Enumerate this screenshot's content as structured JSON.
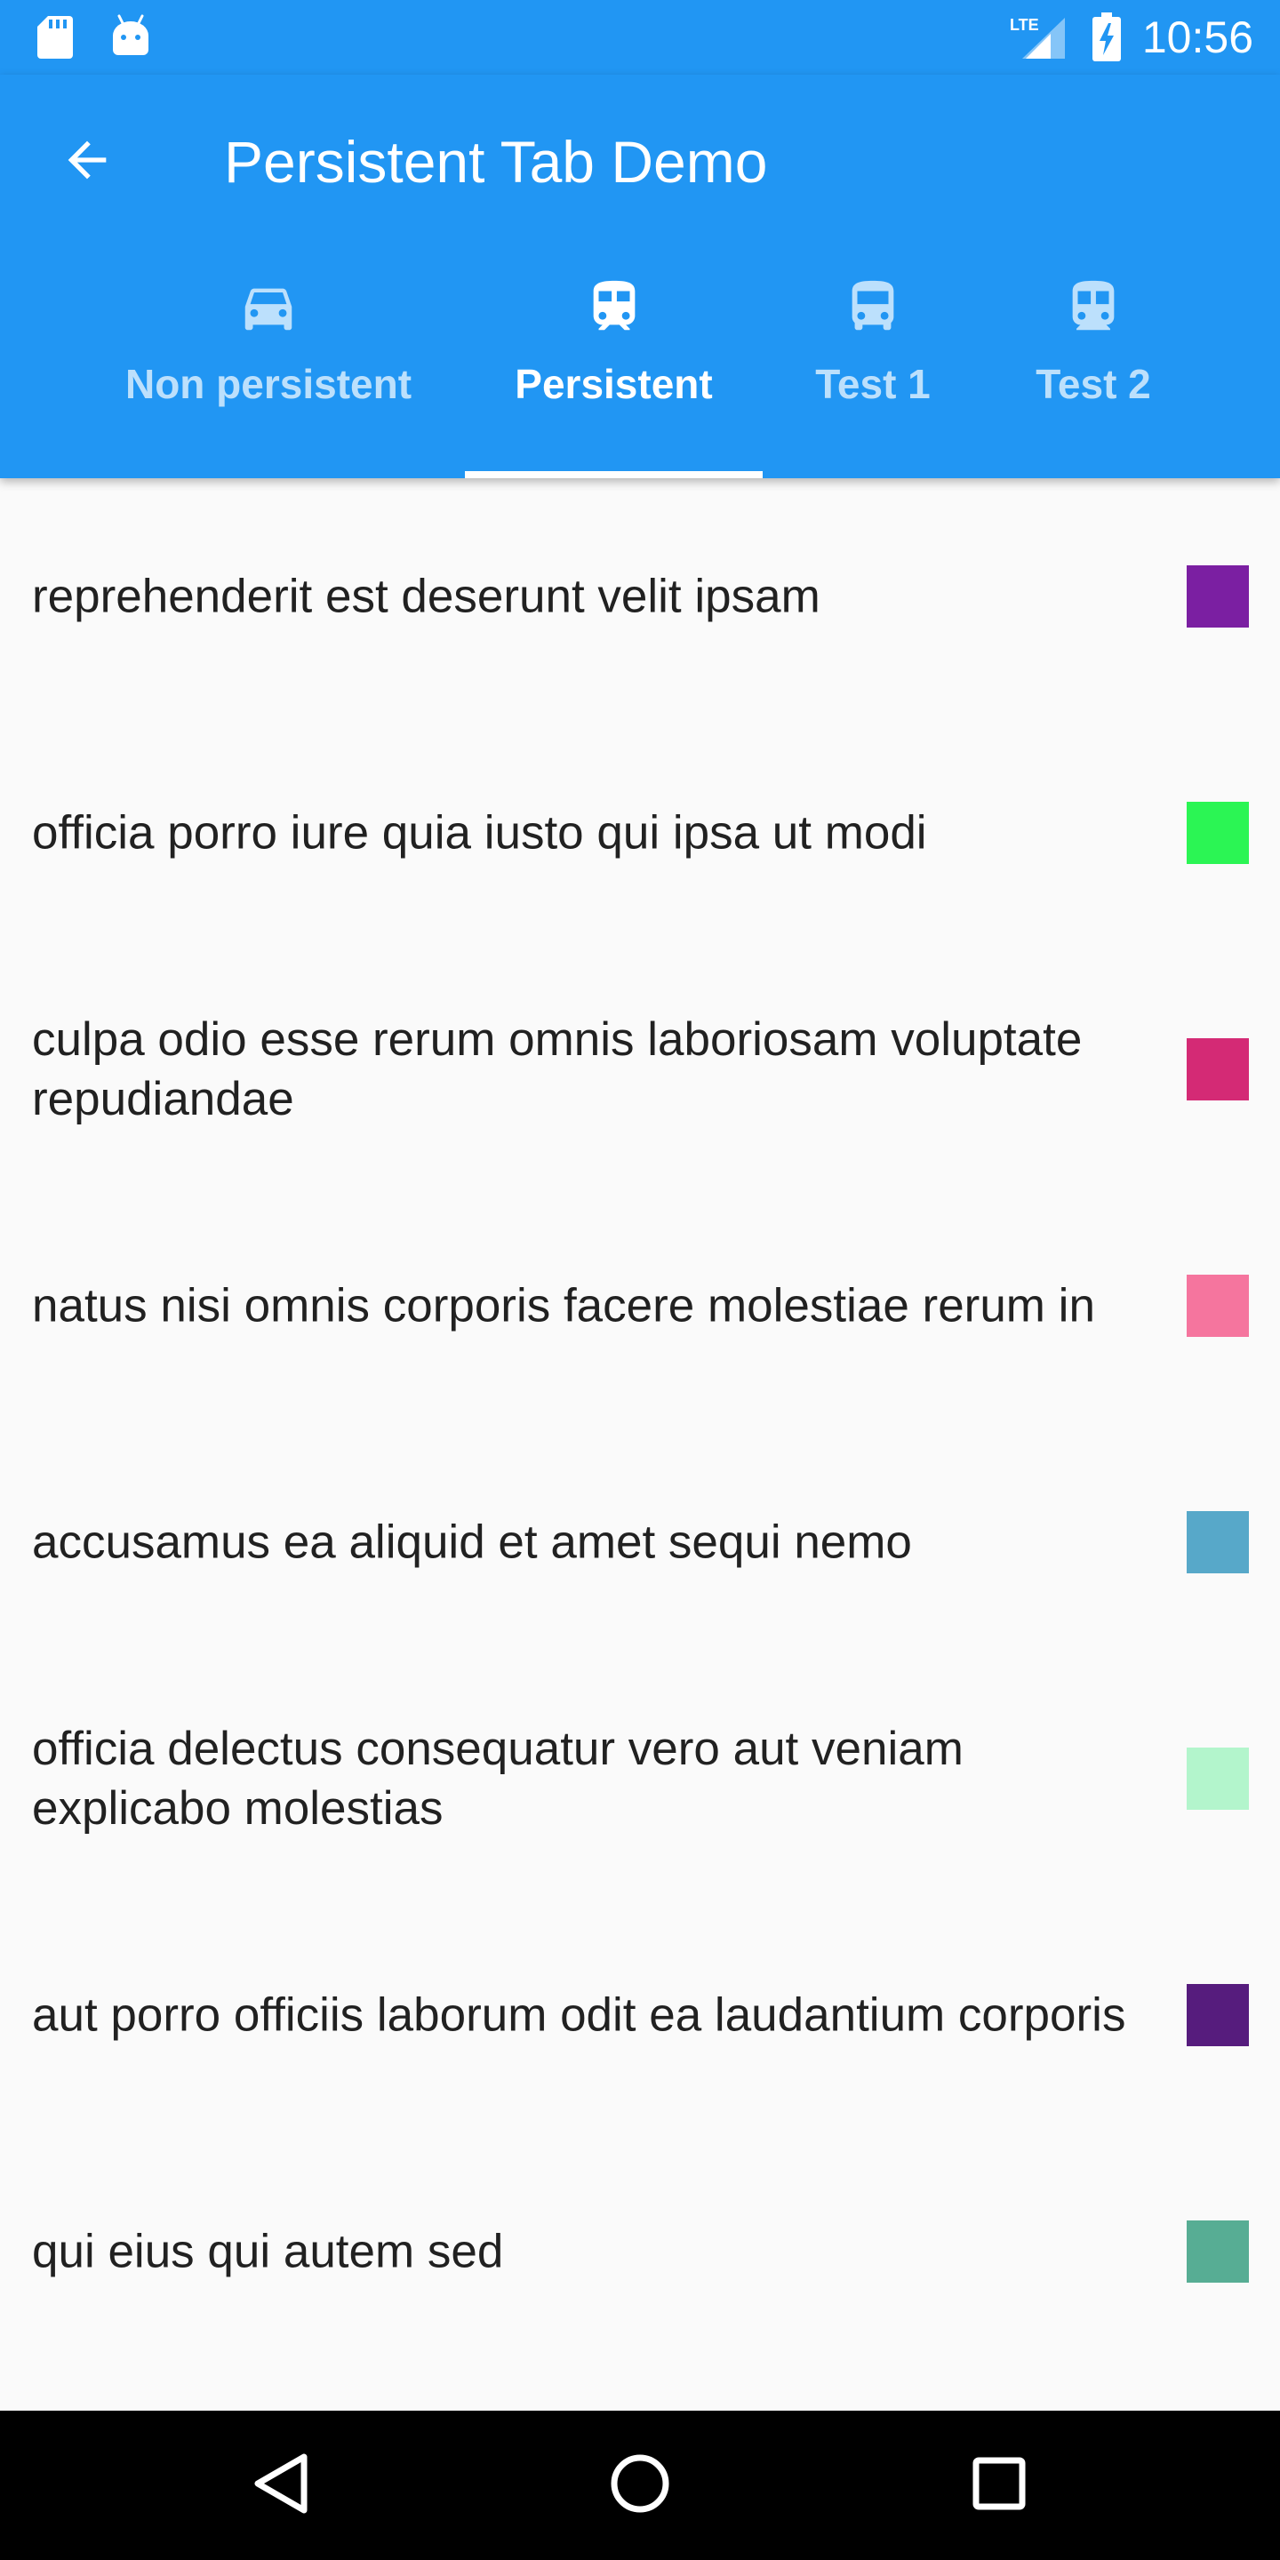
{
  "status_bar": {
    "time": "10:56",
    "icons": [
      "sd-card-icon",
      "android-icon",
      "lte-signal-icon",
      "battery-charging-icon"
    ]
  },
  "app_bar": {
    "title": "Persistent Tab Demo",
    "back_icon": "arrow-back-icon",
    "color": "#2196f3"
  },
  "tabs": [
    {
      "label": "Non persistent",
      "icon": "car-icon",
      "active": false
    },
    {
      "label": "Persistent",
      "icon": "train-icon",
      "active": true
    },
    {
      "label": "Test 1",
      "icon": "tram-icon",
      "active": false
    },
    {
      "label": "Test 2",
      "icon": "subway-icon",
      "active": false
    }
  ],
  "list": {
    "items": [
      {
        "text": "reprehenderit est deserunt velit ipsam",
        "color": "#7b1fa2"
      },
      {
        "text": "officia porro iure quia iusto qui ipsa ut modi",
        "color": "#2bf554"
      },
      {
        "text": "culpa odio esse rerum omnis laboriosam voluptate repudiandae",
        "color": "#d42a75"
      },
      {
        "text": "natus nisi omnis corporis facere molestiae rerum in",
        "color": "#f5759e"
      },
      {
        "text": "accusamus ea aliquid et amet sequi nemo",
        "color": "#57a8c9"
      },
      {
        "text": "officia delectus consequatur vero aut veniam explicabo molestias",
        "color": "#b3f5cc"
      },
      {
        "text": "aut porro officiis laborum odit ea laudantium corporis",
        "color": "#561c7d"
      },
      {
        "text": "qui eius qui autem sed",
        "color": "#57ad94"
      }
    ]
  },
  "nav_bar": {
    "buttons": [
      "back-triangle-icon",
      "home-circle-icon",
      "recents-square-icon"
    ]
  }
}
